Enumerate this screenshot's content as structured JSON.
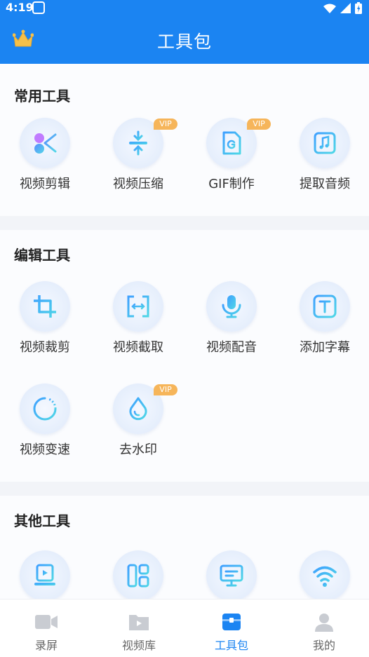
{
  "status": {
    "time": "4:19"
  },
  "header": {
    "title": "工具包"
  },
  "sections": [
    {
      "title": "常用工具",
      "tools": [
        {
          "label": "视频剪辑",
          "icon": "scissors-icon",
          "vip": ""
        },
        {
          "label": "视频压缩",
          "icon": "compress-icon",
          "vip": "VIP"
        },
        {
          "label": "GIF制作",
          "icon": "gif-icon",
          "vip": "VIP"
        },
        {
          "label": "提取音频",
          "icon": "music-icon",
          "vip": ""
        }
      ]
    },
    {
      "title": "编辑工具",
      "tools": [
        {
          "label": "视频裁剪",
          "icon": "crop-icon",
          "vip": ""
        },
        {
          "label": "视频截取",
          "icon": "trim-icon",
          "vip": ""
        },
        {
          "label": "视频配音",
          "icon": "microphone-icon",
          "vip": ""
        },
        {
          "label": "添加字幕",
          "icon": "subtitle-icon",
          "vip": ""
        },
        {
          "label": "视频变速",
          "icon": "speed-icon",
          "vip": ""
        },
        {
          "label": "去水印",
          "icon": "watermark-drop-icon",
          "vip": "VIP"
        }
      ]
    },
    {
      "title": "其他工具",
      "tools": [
        {
          "label": "",
          "icon": "screen-record-icon",
          "vip": ""
        },
        {
          "label": "",
          "icon": "layout-icon",
          "vip": ""
        },
        {
          "label": "",
          "icon": "monitor-icon",
          "vip": ""
        },
        {
          "label": "",
          "icon": "wifi-icon",
          "vip": ""
        }
      ]
    }
  ],
  "tabbar": [
    {
      "label": "录屏",
      "icon": "camera-icon",
      "active": false
    },
    {
      "label": "视频库",
      "icon": "video-folder-icon",
      "active": false
    },
    {
      "label": "工具包",
      "icon": "toolbox-icon",
      "active": true
    },
    {
      "label": "我的",
      "icon": "user-icon",
      "active": false
    }
  ],
  "colors": {
    "primary": "#1b84f2",
    "vip": "#f6b55a",
    "icon_gradient_start": "#3fa0ff",
    "icon_gradient_end": "#4fd7e6"
  }
}
